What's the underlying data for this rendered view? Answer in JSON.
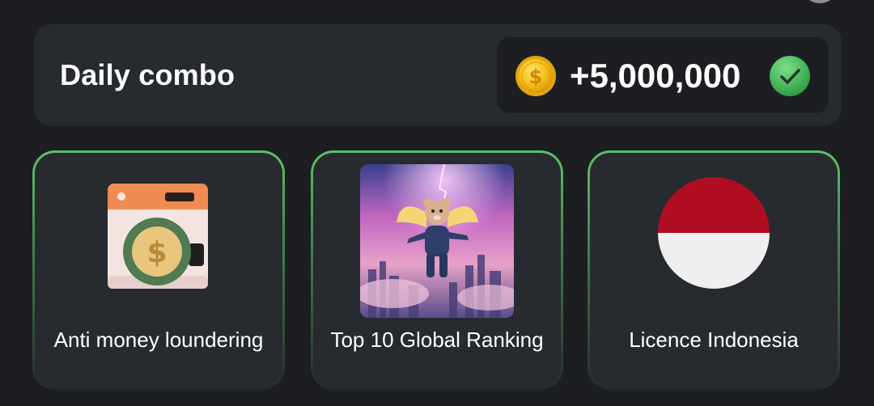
{
  "combo": {
    "title": "Daily combo",
    "reward": "+5,000,000",
    "coin_icon": "dollar-coin-icon",
    "check_icon": "checkmark-icon"
  },
  "cards": [
    {
      "label": "Anti money loundering",
      "image": "washing-machine-coin-icon"
    },
    {
      "label": "Top 10 Global Ranking",
      "image": "flying-hamster-image"
    },
    {
      "label": "Licence Indonesia",
      "image": "indonesia-flag-icon"
    }
  ],
  "colors": {
    "accent_green": "#5fc067",
    "panel": "#272a2f",
    "background": "#1c1e22",
    "coin_gold": "#f5c21b",
    "flag_red": "#b00d23"
  }
}
